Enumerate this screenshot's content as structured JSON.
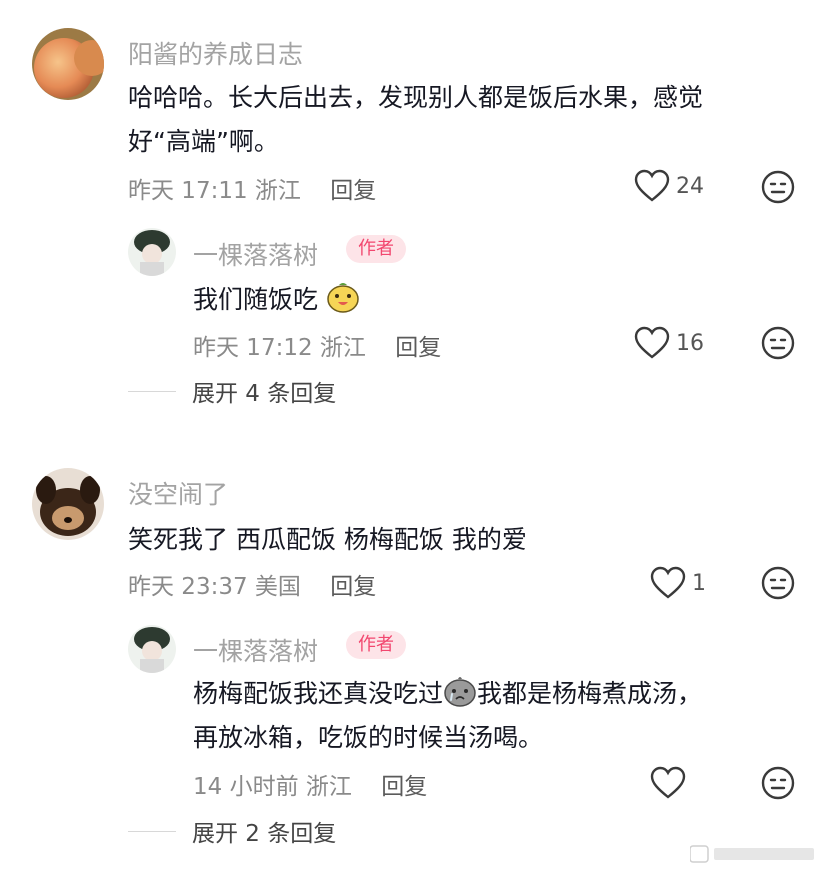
{
  "comments": [
    {
      "username": "阳酱的养成日志",
      "text_line1": "哈哈哈。长大后出去，发现别人都是饭后水果，感觉",
      "text_line2": "好“高端”啊。",
      "time": "昨天 17:11",
      "location": "浙江",
      "reply_label": "回复",
      "likes": "24",
      "reply": {
        "username": "一棵落落树",
        "badge": "作者",
        "text": "我们随饭吃",
        "time": "昨天 17:12",
        "location": "浙江",
        "reply_label": "回复",
        "likes": "16"
      },
      "expand_label": "展开 4 条回复"
    },
    {
      "username": "没空闹了",
      "text_line1": "笑死我了 西瓜配饭 杨梅配饭 我的爱",
      "time": "昨天 23:37",
      "location": "美国",
      "reply_label": "回复",
      "likes": "1",
      "reply": {
        "username": "一棵落落树",
        "badge": "作者",
        "text_line1_a": "杨梅配饭我还真没吃过",
        "text_line1_b": "我都是杨梅煮成汤，",
        "text_line2": "再放冰箱，吃饭的时候当汤喝。",
        "time": "14 小时前",
        "location": "浙江",
        "reply_label": "回复",
        "likes": ""
      },
      "expand_label": "展开 2 条回复"
    }
  ],
  "colors": {
    "author_badge_bg": "#fde4e8",
    "author_badge_text": "#f2476f",
    "username": "#a3a3a3",
    "content": "#161823"
  },
  "icons": [
    "heart-outline-icon",
    "dislike-face-icon",
    "peach-avatar",
    "dog-avatar",
    "author-avatar",
    "smiling-emoji",
    "crying-emoji"
  ]
}
